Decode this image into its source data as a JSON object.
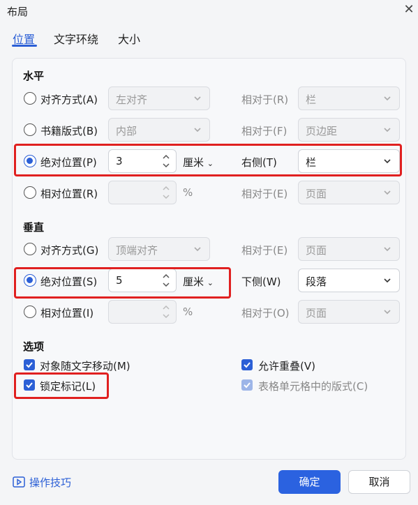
{
  "window": {
    "title": "布局",
    "close_icon": "close-icon"
  },
  "tabs": [
    {
      "label": "位置",
      "active": true
    },
    {
      "label": "文字环绕",
      "active": false
    },
    {
      "label": "大小",
      "active": false
    }
  ],
  "horizontal": {
    "title": "水平",
    "rows": [
      {
        "label": "对齐方式(A)",
        "checked": false,
        "value": "左对齐",
        "relative_label": "相对于(R)",
        "relative_value": "栏"
      },
      {
        "label": "书籍版式(B)",
        "checked": false,
        "value": "内部",
        "relative_label": "相对于(F)",
        "relative_value": "页边距"
      },
      {
        "label": "绝对位置(P)",
        "checked": true,
        "value": "3",
        "unit": "厘米",
        "relative_label": "右侧(T)",
        "relative_value": "栏"
      },
      {
        "label": "相对位置(R)",
        "checked": false,
        "value": "",
        "unit": "%",
        "relative_label": "相对于(E)",
        "relative_value": "页面"
      }
    ]
  },
  "vertical": {
    "title": "垂直",
    "rows": [
      {
        "label": "对齐方式(G)",
        "checked": false,
        "value": "顶端对齐",
        "relative_label": "相对于(E)",
        "relative_value": "页面"
      },
      {
        "label": "绝对位置(S)",
        "checked": true,
        "value": "5",
        "unit": "厘米",
        "relative_label": "下侧(W)",
        "relative_value": "段落"
      },
      {
        "label": "相对位置(I)",
        "checked": false,
        "value": "",
        "unit": "%",
        "relative_label": "相对于(O)",
        "relative_value": "页面"
      }
    ]
  },
  "options": {
    "title": "选项",
    "items": [
      {
        "label": "对象随文字移动(M)",
        "checked": true,
        "disabled": false
      },
      {
        "label": "允许重叠(V)",
        "checked": true,
        "disabled": false
      },
      {
        "label": "锁定标记(L)",
        "checked": true,
        "disabled": false
      },
      {
        "label": "表格单元格中的版式(C)",
        "checked": true,
        "disabled": true
      }
    ]
  },
  "footer": {
    "tips_label": "操作技巧",
    "ok_label": "确定",
    "cancel_label": "取消"
  },
  "colors": {
    "accent": "#2b5fd6",
    "highlight": "#e02020"
  }
}
